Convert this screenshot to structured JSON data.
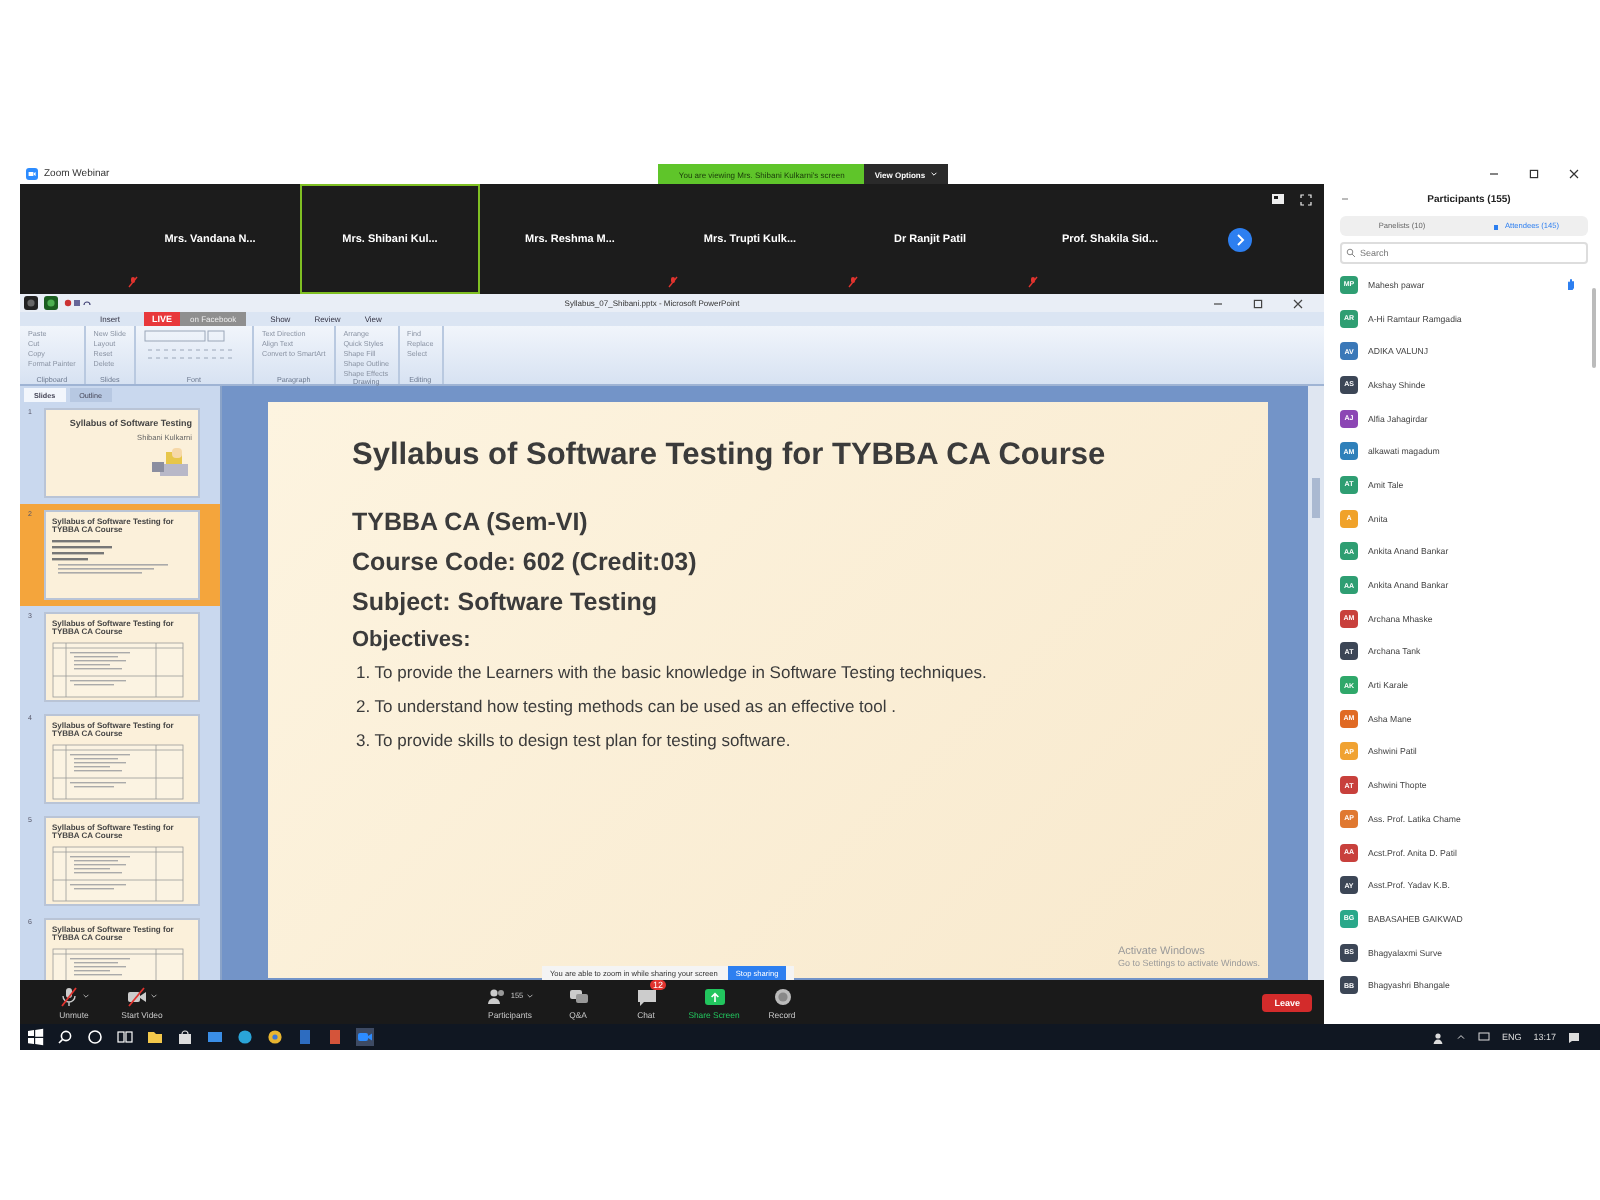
{
  "window": {
    "title": "Zoom Webinar"
  },
  "share_banner": {
    "text": "You are viewing Mrs. Shibani Kulkarni's screen",
    "options": "View Options"
  },
  "video_tiles": [
    {
      "name": "Mrs. Vandana N...",
      "muted": true,
      "selected": false
    },
    {
      "name": "Mrs. Shibani Kul...",
      "muted": false,
      "selected": true
    },
    {
      "name": "Mrs. Reshma M...",
      "muted": false,
      "selected": false
    },
    {
      "name": "Mrs. Trupti Kulk...",
      "muted": true,
      "selected": false
    },
    {
      "name": "Dr Ranjit Patil",
      "muted": true,
      "selected": false
    },
    {
      "name": "Prof. Shakila Sid...",
      "muted": true,
      "selected": false
    }
  ],
  "powerpoint": {
    "title": "Syllabus_07_Shibani.pptx - Microsoft PowerPoint",
    "live_badge": "LIVE",
    "live_label": "on Facebook",
    "tabs": [
      "Insert",
      "Show",
      "Review",
      "View"
    ],
    "groups": [
      {
        "label": "Clipboard",
        "buttons": [
          "Paste",
          "Cut",
          "Copy",
          "Format Painter"
        ]
      },
      {
        "label": "Slides",
        "buttons": [
          "New Slide",
          "Layout",
          "Reset",
          "Delete"
        ]
      },
      {
        "label": "Font"
      },
      {
        "label": "Paragraph",
        "buttons": [
          "Text Direction",
          "Align Text",
          "Convert to SmartArt"
        ]
      },
      {
        "label": "Drawing",
        "buttons": [
          "Arrange",
          "Quick Styles",
          "Shape Fill",
          "Shape Outline",
          "Shape Effects"
        ]
      },
      {
        "label": "Editing",
        "buttons": [
          "Find",
          "Replace",
          "Select"
        ]
      }
    ],
    "pane_tabs": [
      {
        "label": "Slides",
        "selected": true
      },
      {
        "label": "Outline",
        "selected": false
      }
    ],
    "thumbnails": [
      {
        "number": "1",
        "kind": "title",
        "title": "Syllabus of Software Testing",
        "subtitle": "Shibani Kulkarni",
        "selected": false
      },
      {
        "number": "2",
        "kind": "text",
        "title": "Syllabus of Software Testing for TYBBA CA Course",
        "selected": true
      },
      {
        "number": "3",
        "kind": "table",
        "title": "Syllabus of Software Testing for TYBBA CA Course",
        "selected": false
      },
      {
        "number": "4",
        "kind": "table",
        "title": "Syllabus of Software Testing for TYBBA CA Course",
        "selected": false
      },
      {
        "number": "5",
        "kind": "table",
        "title": "Syllabus of Software Testing for TYBBA CA Course",
        "selected": false
      },
      {
        "number": "6",
        "kind": "table",
        "title": "Syllabus of Software Testing for TYBBA CA Course",
        "selected": false
      }
    ]
  },
  "slide": {
    "title": "Syllabus of Software Testing for TYBBA CA Course",
    "lines": [
      "TYBBA CA (Sem-VI)",
      "Course Code: 602 (Credit:03)",
      "Subject:  Software Testing"
    ],
    "objectives_heading": "Objectives:",
    "objectives": [
      "1.  To provide the Learners with the basic knowledge in Software Testing techniques.",
      "2.  To understand how testing methods can be used as an effective tool .",
      "3.  To provide skills to design test plan for testing software."
    ]
  },
  "activation": {
    "title": "Activate Windows",
    "text": "Go to Settings to activate Windows."
  },
  "share_bar": {
    "text": "You are able to zoom in while sharing your screen",
    "button": "Stop sharing"
  },
  "toolbar": [
    {
      "kind": "mic",
      "label": "Unmute"
    },
    {
      "kind": "video",
      "label": "Start Video"
    },
    {
      "kind": "participants",
      "label": "Participants",
      "count": "155"
    },
    {
      "kind": "qa",
      "label": "Q&A"
    },
    {
      "kind": "chat",
      "label": "Chat",
      "badge": "12"
    },
    {
      "kind": "share",
      "label": "Share Screen"
    },
    {
      "kind": "record",
      "label": "Record"
    }
  ],
  "leave": "Leave",
  "participants": {
    "title": "Participants (155)",
    "tabs": [
      {
        "label": "Panelists (10)",
        "selected": false
      },
      {
        "label": "Attendees (145)",
        "selected": true
      }
    ],
    "search": {
      "placeholder": "Search"
    },
    "list": [
      {
        "initials": "MP",
        "name": "Mahesh pawar",
        "color": "#2e9e72",
        "hand_raised": true
      },
      {
        "initials": "AR",
        "name": "A-Hi Ramtaur Ramgadia",
        "color": "#2e9e72",
        "hand_raised": false
      },
      {
        "initials": "AV",
        "name": "ADIKA VALUNJ",
        "color": "#3a78b8",
        "hand_raised": false
      },
      {
        "initials": "AS",
        "name": "Akshay Shinde",
        "color": "#3c4656",
        "hand_raised": false
      },
      {
        "initials": "AJ",
        "name": "Alfia Jahagirdar",
        "color": "#8c46b4",
        "hand_raised": false
      },
      {
        "initials": "AM",
        "name": "alkawati magadum",
        "color": "#2f80ba",
        "hand_raised": false
      },
      {
        "initials": "AT",
        "name": "Amit Tale",
        "color": "#2e9e72",
        "hand_raised": false
      },
      {
        "initials": "A",
        "name": "Anita",
        "color": "#f0a22a",
        "hand_raised": false
      },
      {
        "initials": "AA",
        "name": "Ankita Anand Bankar",
        "color": "#2e9e72",
        "hand_raised": false
      },
      {
        "initials": "AA",
        "name": "Ankita Anand Bankar",
        "color": "#2e9e72",
        "hand_raised": false
      },
      {
        "initials": "AM",
        "name": "Archana Mhaske",
        "color": "#c8403c",
        "hand_raised": false
      },
      {
        "initials": "AT",
        "name": "Archana Tank",
        "color": "#3c4656",
        "hand_raised": false
      },
      {
        "initials": "AK",
        "name": "Arti Karale",
        "color": "#2fa86a",
        "hand_raised": false
      },
      {
        "initials": "AM",
        "name": "Asha Mane",
        "color": "#e06a24",
        "hand_raised": false
      },
      {
        "initials": "AP",
        "name": "Ashwini Patil",
        "color": "#f0a232",
        "hand_raised": false
      },
      {
        "initials": "AT",
        "name": "Ashwini Thopte",
        "color": "#c8403c",
        "hand_raised": false
      },
      {
        "initials": "AP",
        "name": "Ass. Prof. Latika Chame",
        "color": "#e07830",
        "hand_raised": false
      },
      {
        "initials": "AA",
        "name": "Acst.Prof. Anita D. Patil",
        "color": "#c8403c",
        "hand_raised": false
      },
      {
        "initials": "AY",
        "name": "Asst.Prof. Yadav K.B.",
        "color": "#3c4656",
        "hand_raised": false
      },
      {
        "initials": "BG",
        "name": "BABASAHEB GAIKWAD",
        "color": "#2aa88a",
        "hand_raised": false
      },
      {
        "initials": "BS",
        "name": "Bhagyalaxmi Surve",
        "color": "#3c4656",
        "hand_raised": false
      },
      {
        "initials": "BB",
        "name": "Bhagyashri Bhangale",
        "color": "#3c4656",
        "hand_raised": false
      }
    ]
  },
  "taskbar": {
    "language": "ENG",
    "time": "13:17"
  }
}
